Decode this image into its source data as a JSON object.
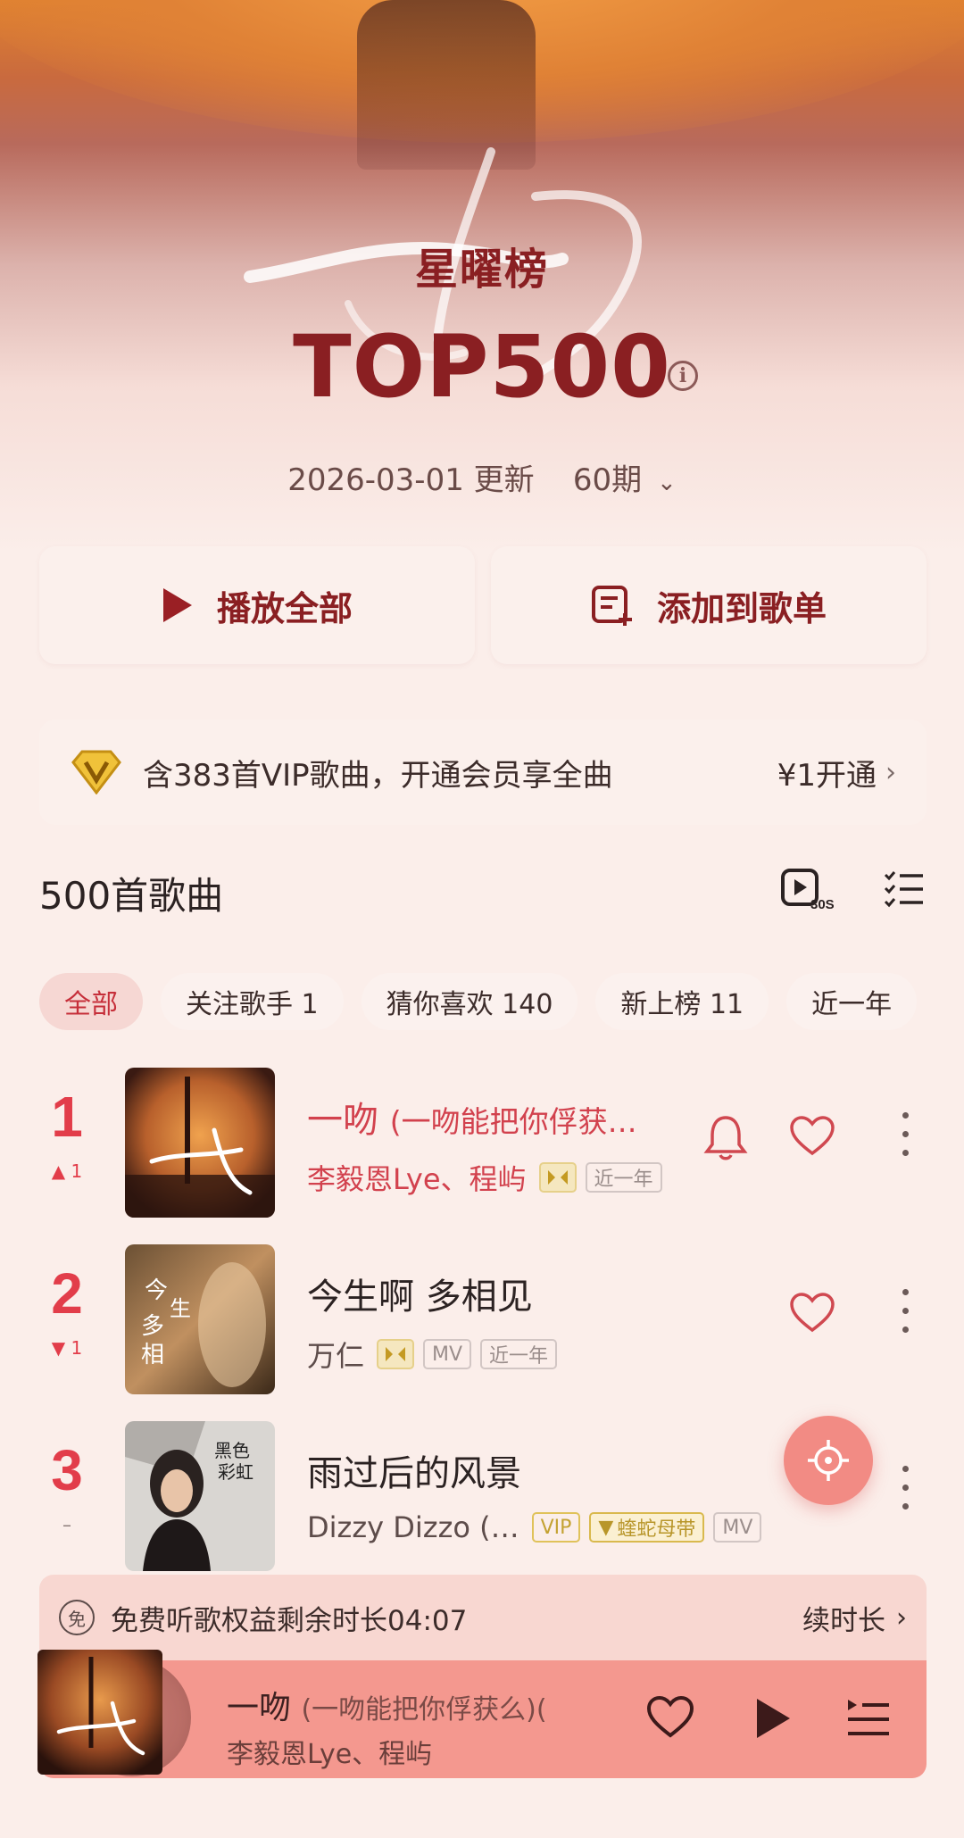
{
  "header": {
    "title_small": "星曜榜",
    "title_big": "TOP500",
    "update_text": "2026-03-01 更新",
    "period": "60期"
  },
  "actions": {
    "play_all": "播放全部",
    "add_to_playlist": "添加到歌单"
  },
  "vip_bar": {
    "text": "含383首VIP歌曲，开通会员享全曲",
    "action": "¥1开通"
  },
  "list": {
    "count_title": "500首歌曲",
    "preview_badge": "30S",
    "filters": [
      "全部",
      "关注歌手 1",
      "猜你喜欢 140",
      "新上榜 11",
      "近一年"
    ],
    "active_filter": 0
  },
  "songs": [
    {
      "rank": "1",
      "trend": "▲ 1",
      "title": "一吻",
      "subtitle": "(一吻能把你俘获…",
      "artist": "李毅恩Lye、程屿",
      "tags": [
        "近一年"
      ]
    },
    {
      "rank": "2",
      "trend": "▼ 1",
      "title": "今生啊 多相见",
      "subtitle": "",
      "artist": "万仁",
      "tags": [
        "MV",
        "近一年"
      ]
    },
    {
      "rank": "3",
      "trend": "–",
      "title": "雨过后的风景",
      "subtitle": "",
      "artist": "Dizzy Dizzo (…",
      "tags": [
        "VIP",
        "蝰蛇母带",
        "MV"
      ]
    }
  ],
  "free_bar": {
    "badge": "免",
    "text": "免费听歌权益剩余时长04:07",
    "action": "续时长"
  },
  "player": {
    "title": "一吻",
    "subtitle": "(一吻能把你俘获么)(",
    "artist": "李毅恩Lye、程屿"
  },
  "colors": {
    "accent_red": "#e23d4a",
    "title_red": "#8a1f22",
    "player_bg": "#f4988f",
    "gold_tag": "#d9b94d"
  }
}
